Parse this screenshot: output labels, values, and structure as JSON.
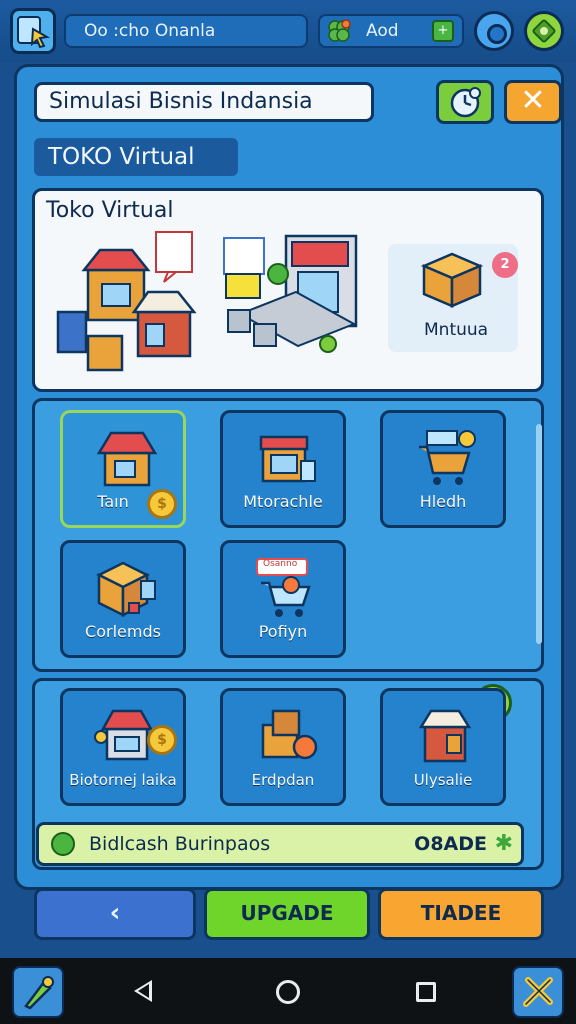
{
  "topbar": {
    "title": "Oo :cho Onanla",
    "add_label": "Aod",
    "add_plus": "+"
  },
  "header": {
    "title": "Simulasi Bisnis Indansia",
    "tab_label": "TOKO Virtual",
    "close_glyph": "✕"
  },
  "showcase": {
    "title": "Toko Virtual",
    "feature_label": "Mntuua",
    "badge": "2"
  },
  "grid_tiles": [
    {
      "label": "Taın",
      "coin": "$"
    },
    {
      "label": "Mtorachle"
    },
    {
      "label": "Hledh"
    },
    {
      "label": "Corlemds"
    },
    {
      "label": "Pofiyn",
      "sign": "Osanno"
    }
  ],
  "bottom_tiles": [
    {
      "label": "Biotornej laika",
      "coin": "$"
    },
    {
      "label": "Erdpdan"
    },
    {
      "label": "Ulysalie"
    }
  ],
  "banner": {
    "text": "Bidlcash Burinpaos",
    "amount": "O8ADE",
    "star": "✱"
  },
  "actions": {
    "back": "‹",
    "upgrade": "UPGADE",
    "trade": "TIADEE"
  },
  "colors": {
    "panel": "#2b8ed6",
    "upgrade": "#6fd52a",
    "trade": "#f9a531",
    "back": "#3d71d0"
  }
}
